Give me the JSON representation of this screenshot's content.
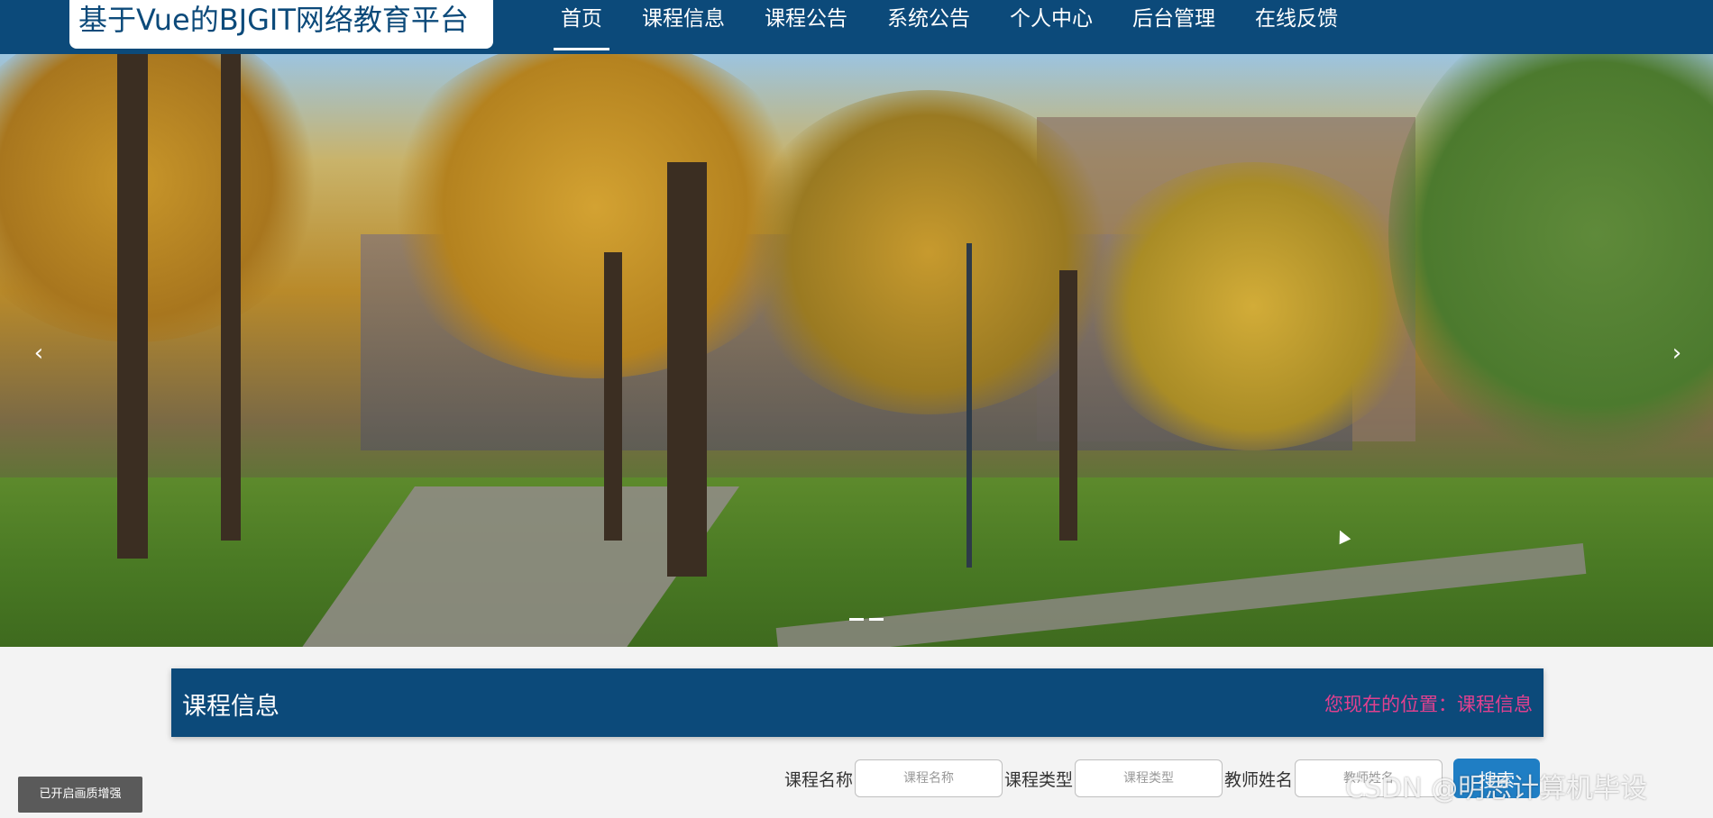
{
  "header": {
    "brand": "基于Vue的BJGIT网络教育平台",
    "nav": [
      {
        "label": "首页",
        "active": true
      },
      {
        "label": "课程信息",
        "active": false
      },
      {
        "label": "课程公告",
        "active": false
      },
      {
        "label": "系统公告",
        "active": false
      },
      {
        "label": "个人中心",
        "active": false
      },
      {
        "label": "后台管理",
        "active": false
      },
      {
        "label": "在线反馈",
        "active": false
      }
    ]
  },
  "carousel": {
    "prev_icon": "‹",
    "next_icon": "›",
    "slides": 2,
    "active_index": 0
  },
  "section": {
    "title": "课程信息",
    "breadcrumb": "您现在的位置：课程信息"
  },
  "search": {
    "fields": [
      {
        "label": "课程名称",
        "placeholder": "课程名称"
      },
      {
        "label": "课程类型",
        "placeholder": "课程类型"
      },
      {
        "label": "教师姓名",
        "placeholder": "教师姓名"
      }
    ],
    "button_label": "搜索"
  },
  "toast": "已开启画质增强",
  "watermark": "CSDN @明思计算机毕设",
  "colors": {
    "primary": "#0c4a7a",
    "breadcrumb": "#e0408f",
    "button": "#1f7ec4"
  }
}
